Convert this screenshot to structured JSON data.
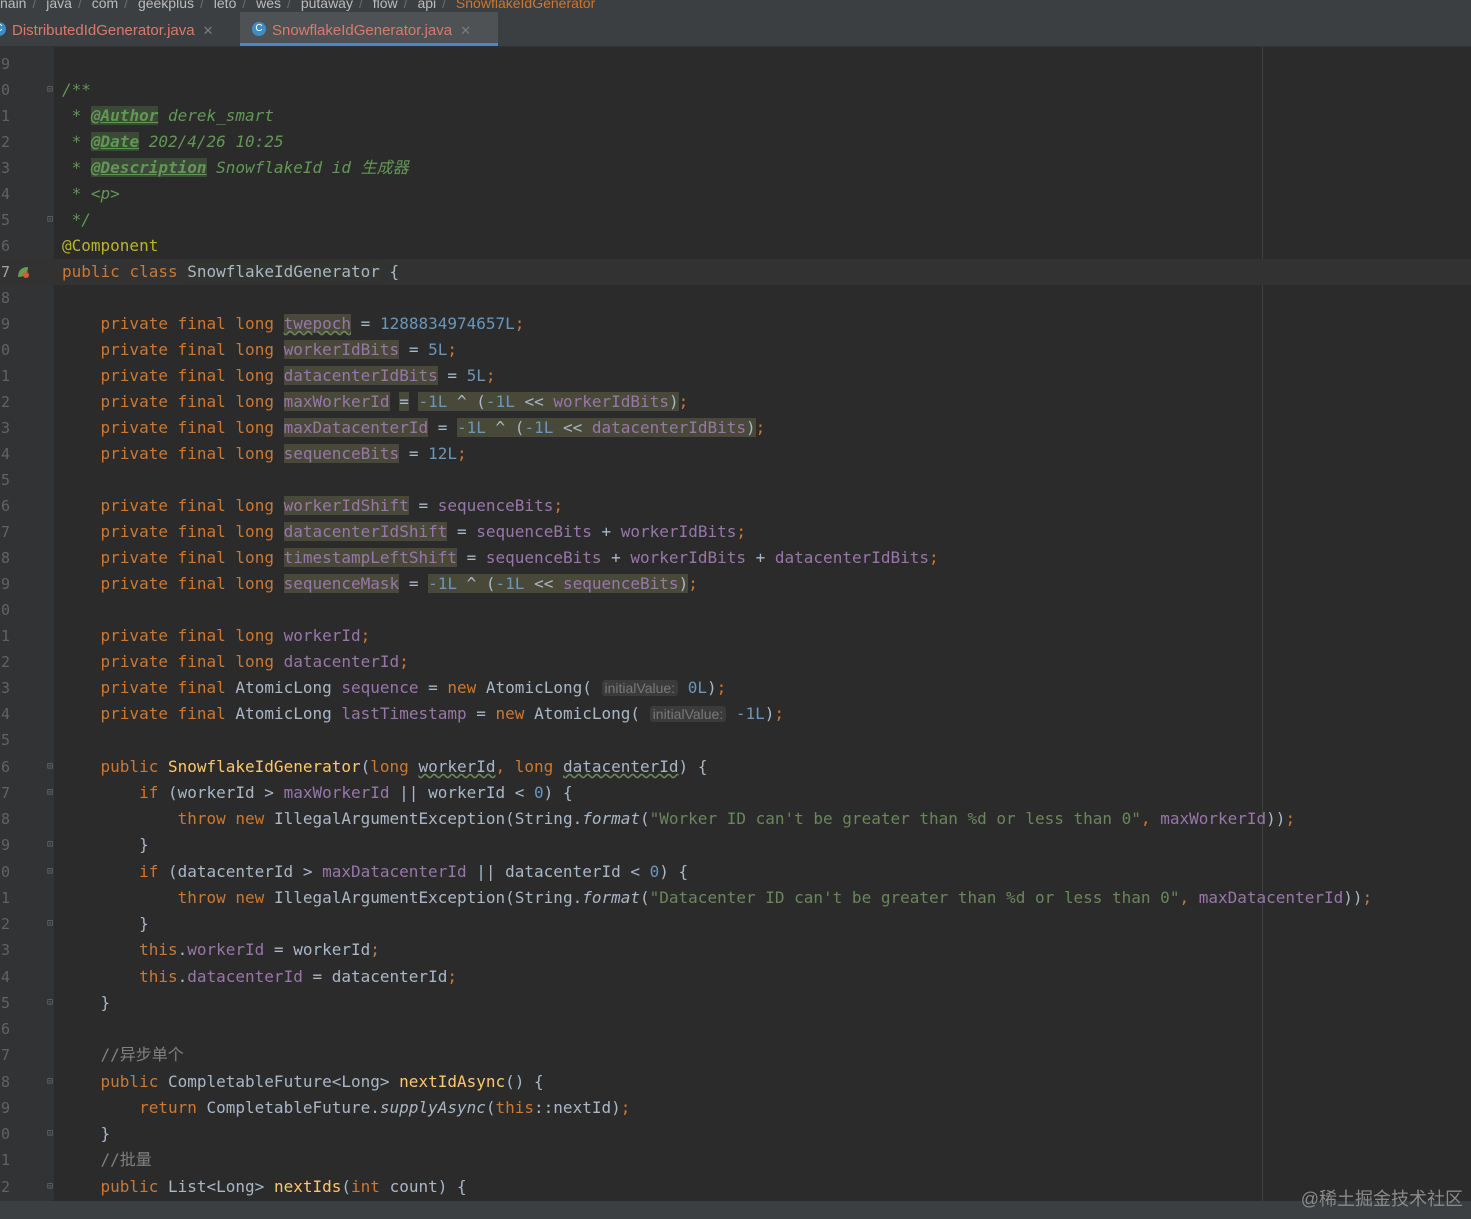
{
  "breadcrumb": [
    "nain",
    "java",
    "com",
    "geekplus",
    "leto",
    "wes",
    "putaway",
    "flow",
    "api",
    "SnowflakeIdGenerator"
  ],
  "tabs": [
    {
      "label": "DistributedIdGenerator.java",
      "icon": "C",
      "active": false
    },
    {
      "label": "SnowflakeIdGenerator.java",
      "icon": "C",
      "active": true
    }
  ],
  "line_numbers": [
    "9",
    "0",
    "1",
    "2",
    "3",
    "4",
    "5",
    "6",
    "7",
    "8",
    "9",
    "0",
    "1",
    "2",
    "3",
    "4",
    "5",
    "6",
    "7",
    "8",
    "9",
    "0",
    "1",
    "2",
    "3",
    "4",
    "5",
    "6",
    "7",
    "8",
    "9",
    "0",
    "1",
    "2",
    "3",
    "4",
    "5",
    "6",
    "7",
    "8",
    "9",
    "0",
    "1",
    "2"
  ],
  "code": {
    "doc_open": "/**",
    "doc_star": " * ",
    "author_tag": "@Author",
    "author_val": " derek_smart",
    "date_tag": "@Date",
    "date_val": " 202/4/26 10:25",
    "desc_tag": "@Description",
    "desc_val": " SnowflakeId id 生成器",
    "p_line": " * <p>",
    "doc_close": " */",
    "annotation": "@Component",
    "public": "public",
    "class": "class",
    "class_name": "SnowflakeIdGenerator",
    "private": "private",
    "final": "final",
    "long": "long",
    "int": "int",
    "new": "new",
    "if": "if",
    "throw": "throw",
    "this": "this",
    "return": "return",
    "AtomicLong": "AtomicLong",
    "twepoch": "twepoch",
    "twepoch_val": "1288834974657L",
    "workerIdBits": "workerIdBits",
    "datacenterIdBits": "datacenterIdBits",
    "maxWorkerId": "maxWorkerId",
    "maxDatacenterId": "maxDatacenterId",
    "sequenceBits": "sequenceBits",
    "workerIdShift": "workerIdShift",
    "datacenterIdShift": "datacenterIdShift",
    "timestampLeftShift": "timestampLeftShift",
    "sequenceMask": "sequenceMask",
    "workerId": "workerId",
    "datacenterId": "datacenterId",
    "sequence": "sequence",
    "lastTimestamp": "lastTimestamp",
    "five": "5L",
    "twelve": "12L",
    "minus_one": "-1L",
    "zero": "0",
    "zeroL": "0L",
    "hint_initial": "initialValue:",
    "illegal": "IllegalArgumentException(String.",
    "format": "format",
    "msg_worker": "\"Worker ID can't be greater than %d or less than 0\"",
    "msg_dc": "\"Datacenter ID can't be greater than %d or less than 0\"",
    "comment_async": "//异步单个",
    "comment_batch": "//批量",
    "completable": "CompletableFuture<Long>",
    "completable_cls": "CompletableFuture.",
    "nextIdAsync": "nextIdAsync",
    "supplyAsync": "supplyAsync",
    "nextId": "::nextId",
    "list_long": "List<Long>",
    "nextIds": "nextIds",
    "count": "count"
  },
  "watermark": "@稀土掘金技术社区"
}
